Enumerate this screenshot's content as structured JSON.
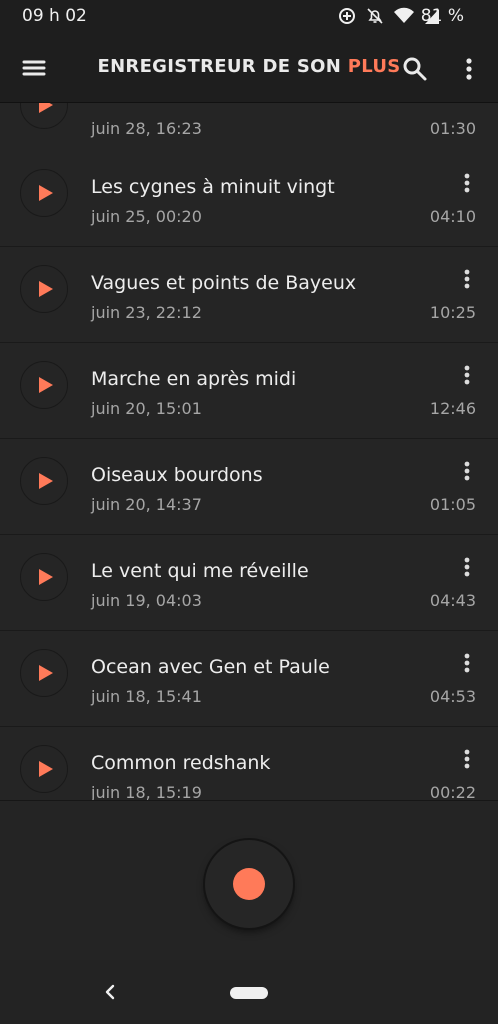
{
  "status_bar": {
    "time": "09 h 02",
    "battery": "81 %",
    "icons": [
      "data-saver-icon",
      "notifications-off-icon",
      "wifi-icon",
      "signal-icon",
      "battery-icon"
    ]
  },
  "app_bar": {
    "title_main": "ENREGISTREUR DE SON ",
    "title_accent": "PLUS",
    "icons": [
      "hamburger-menu-icon",
      "search-icon",
      "more-vert-icon"
    ]
  },
  "colors": {
    "accent": "#ff7a59",
    "background": "#232323",
    "text": "#ededed",
    "secondary_text": "#a6a6a6"
  },
  "recordings": [
    {
      "title": "",
      "date": "juin 28, 16:23",
      "duration": "01:30"
    },
    {
      "title": "Les cygnes à minuit vingt",
      "date": "juin 25, 00:20",
      "duration": "04:10"
    },
    {
      "title": "Vagues et points de Bayeux",
      "date": "juin 23, 22:12",
      "duration": "10:25"
    },
    {
      "title": "Marche en après midi",
      "date": "juin 20, 15:01",
      "duration": "12:46"
    },
    {
      "title": "Oiseaux bourdons",
      "date": "juin 20, 14:37",
      "duration": "01:05"
    },
    {
      "title": "Le vent qui me réveille",
      "date": "juin 19, 04:03",
      "duration": "04:43"
    },
    {
      "title": "Ocean avec Gen et Paule",
      "date": "juin 18, 15:41",
      "duration": "04:53"
    },
    {
      "title": "Common redshank",
      "date": "juin 18, 15:19",
      "duration": "00:22"
    }
  ],
  "record_button": {
    "icon": "record-icon"
  },
  "nav_bar": {
    "icons": [
      "back-icon",
      "home-pill-icon"
    ]
  }
}
